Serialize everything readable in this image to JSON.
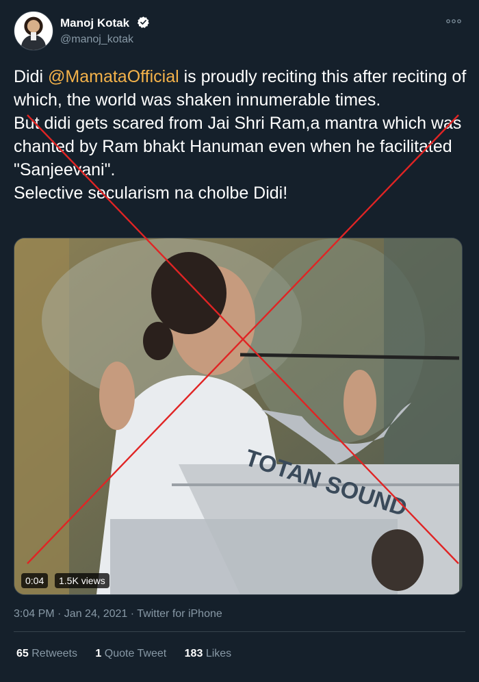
{
  "user": {
    "display_name": "Manoj Kotak",
    "handle": "@manoj_kotak",
    "verified": true
  },
  "tweet": {
    "text_before": "Didi ",
    "mention": "@MamataOfficial",
    "text_after": " is proudly reciting this after reciting of which, the world was shaken innumerable times.\nBut didi gets scared from Jai Shri Ram,a mantra which was chanted by Ram bhakt Hanuman even when he facilitated \"Sanjeevani\".\nSelective secularism na cholbe Didi!"
  },
  "video": {
    "duration": "0:04",
    "views": "1.5K views",
    "podium_sign": "TOTAN SOUND"
  },
  "meta": {
    "timestamp": "3:04 PM · Jan 24, 2021 · Twitter for iPhone"
  },
  "stats": {
    "retweets_count": "65",
    "retweets_label": "Retweets",
    "quote_count": "1",
    "quote_label": "Quote Tweet",
    "likes_count": "183",
    "likes_label": "Likes"
  },
  "colors": {
    "background": "#15202b",
    "mention": "#f4b24a",
    "secondary_text": "#8899a6",
    "verified": "#ffffff",
    "cross": "#e02424"
  },
  "icons": [
    "verified-badge-icon",
    "more-options-icon"
  ]
}
